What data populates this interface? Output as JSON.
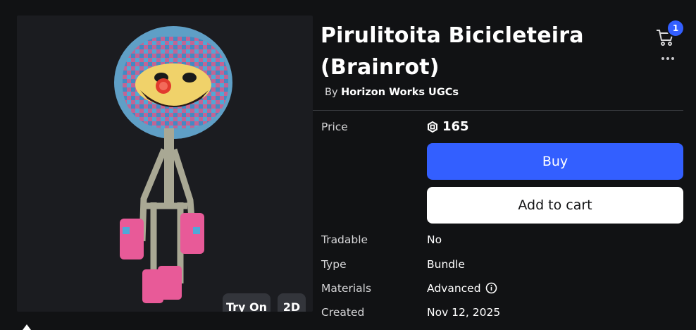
{
  "item": {
    "title": "Pirulitoita Bicicleteira (Brainrot)",
    "creator_prefix": "By",
    "creator_name": "Horizon Works UGCs"
  },
  "preview": {
    "try_on_label": "Try On",
    "view_2d_label": "2D"
  },
  "header": {
    "cart_count": "1",
    "cart_icon": "cart-icon",
    "more_icon": "more-options-icon"
  },
  "purchase": {
    "price_label": "Price",
    "price_value": "165",
    "currency_icon": "robux-icon",
    "buy_label": "Buy",
    "add_to_cart_label": "Add to cart"
  },
  "details": {
    "tradable_label": "Tradable",
    "tradable_value": "No",
    "type_label": "Type",
    "type_value": "Bundle",
    "materials_label": "Materials",
    "materials_value": "Advanced",
    "created_label": "Created",
    "created_value": "Nov 12, 2025"
  },
  "colors": {
    "background": "#111214",
    "panel": "#1b1c20",
    "accent_blue": "#335fff",
    "button_white": "#ffffff",
    "pill_gray": "#33353b"
  }
}
